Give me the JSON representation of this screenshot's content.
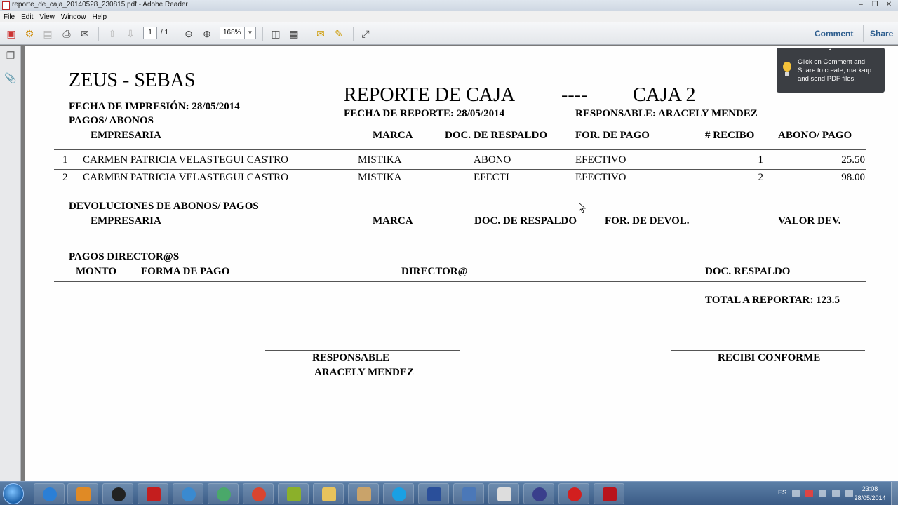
{
  "window": {
    "title": "reporte_de_caja_20140528_230815.pdf - Adobe Reader"
  },
  "menu": [
    "File",
    "Edit",
    "View",
    "Window",
    "Help"
  ],
  "toolbar": {
    "page_current": "1",
    "page_total": "/ 1",
    "zoom": "168%",
    "comment_label": "Comment",
    "share_label": "Share"
  },
  "tooltip": {
    "text": "Click on Comment and Share to create, mark-up and send PDF files."
  },
  "report": {
    "company": "ZEUS - SEBAS",
    "title": "REPORTE DE CAJA",
    "title_sep": "----",
    "caja": "CAJA 2",
    "print_date": "FECHA DE IMPRESIÓN: 28/05/2014",
    "report_date": "FECHA DE REPORTE: 28/05/2014",
    "responsable_hdr": "RESPONSABLE: ARACELY MENDEZ",
    "pagos": {
      "section": "PAGOS/ ABONOS",
      "headers": [
        "EMPRESARIA",
        "MARCA",
        "DOC. DE RESPALDO",
        "FOR. DE PAGO",
        "# RECIBO",
        "ABONO/ PAGO"
      ],
      "rows": [
        {
          "n": "1",
          "empresaria": "CARMEN PATRICIA VELASTEGUI CASTRO",
          "marca": "MISTIKA",
          "doc": "ABONO",
          "forma": "EFECTIVO",
          "recibo": "1",
          "monto": "25.50"
        },
        {
          "n": "2",
          "empresaria": "CARMEN PATRICIA VELASTEGUI CASTRO",
          "marca": "MISTIKA",
          "doc": "EFECTI",
          "forma": "EFECTIVO",
          "recibo": "2",
          "monto": "98.00"
        }
      ]
    },
    "devoluciones": {
      "section": "DEVOLUCIONES DE ABONOS/ PAGOS",
      "headers": [
        "EMPRESARIA",
        "MARCA",
        "DOC. DE RESPALDO",
        "FOR. DE DEVOL.",
        "VALOR DEV."
      ]
    },
    "directores": {
      "section": "PAGOS DIRECTOR@S",
      "headers": [
        "MONTO",
        "FORMA DE PAGO",
        "DIRECTOR@",
        "DOC. RESPALDO"
      ]
    },
    "total": "TOTAL A REPORTAR: 123.5",
    "sign_responsable": "RESPONSABLE",
    "sign_name": "ARACELY MENDEZ",
    "sign_recibi": "RECIBI CONFORME"
  },
  "taskbar": {
    "lang": "ES",
    "time": "23:08",
    "date": "28/05/2014"
  }
}
